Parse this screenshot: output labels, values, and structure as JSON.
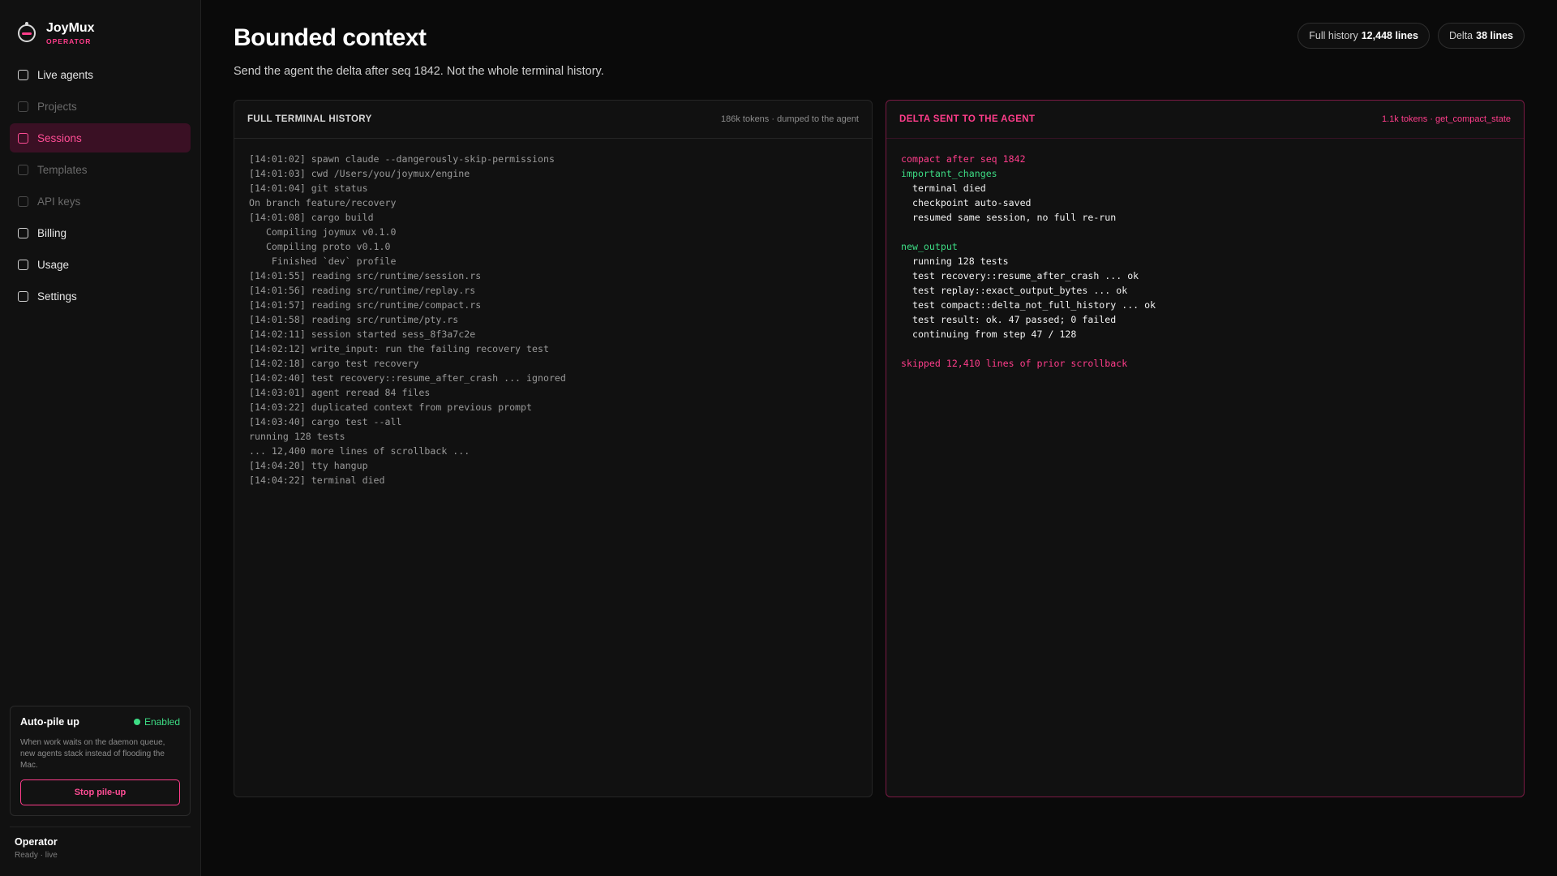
{
  "sidebar": {
    "brand": {
      "name": "JoyMux",
      "role": "OPERATOR"
    },
    "items": [
      {
        "label": "Live agents",
        "state": "normal"
      },
      {
        "label": "Projects",
        "state": "dim"
      },
      {
        "label": "Sessions",
        "state": "active"
      },
      {
        "label": "Templates",
        "state": "dim"
      },
      {
        "label": "API keys",
        "state": "dim"
      },
      {
        "label": "Billing",
        "state": "normal"
      },
      {
        "label": "Usage",
        "state": "normal"
      },
      {
        "label": "Settings",
        "state": "normal"
      }
    ],
    "pile": {
      "title": "Auto-pile up",
      "status": "Enabled",
      "description": "When work waits on the daemon queue, new agents stack instead of flooding the Mac.",
      "button": "Stop pile-up"
    },
    "operator": {
      "name": "Operator",
      "status": "Ready · live"
    }
  },
  "header": {
    "title": "Bounded context",
    "subtitle": "Send the agent the delta after seq 1842. Not the whole terminal history.",
    "pills": [
      {
        "label": "Full history",
        "value": "12,448 lines"
      },
      {
        "label": "Delta",
        "value": "38 lines"
      }
    ]
  },
  "full_panel": {
    "title": "FULL TERMINAL HISTORY",
    "meta": "186k tokens · dumped to the agent",
    "lines": [
      "[14:01:02] spawn claude --dangerously-skip-permissions",
      "[14:01:03] cwd /Users/you/joymux/engine",
      "[14:01:04] git status",
      "On branch feature/recovery",
      "[14:01:08] cargo build",
      "   Compiling joymux v0.1.0",
      "   Compiling proto v0.1.0",
      "    Finished `dev` profile",
      "[14:01:55] reading src/runtime/session.rs",
      "[14:01:56] reading src/runtime/replay.rs",
      "[14:01:57] reading src/runtime/compact.rs",
      "[14:01:58] reading src/runtime/pty.rs",
      "[14:02:11] session started sess_8f3a7c2e",
      "[14:02:12] write_input: run the failing recovery test",
      "[14:02:18] cargo test recovery",
      "[14:02:40] test recovery::resume_after_crash ... ignored",
      "[14:03:01] agent reread 84 files",
      "[14:03:22] duplicated context from previous prompt",
      "[14:03:40] cargo test --all",
      "running 128 tests",
      "... 12,400 more lines of scrollback ...",
      "[14:04:20] tty hangup",
      "[14:04:22] terminal died"
    ]
  },
  "delta_panel": {
    "title": "DELTA SENT TO THE AGENT",
    "meta": "1.1k tokens · get_compact_state",
    "lines": [
      {
        "text": "compact after seq 1842",
        "tone": "pink"
      },
      {
        "text": "important_changes",
        "tone": "green"
      },
      {
        "text": "  terminal died",
        "tone": "normal"
      },
      {
        "text": "  checkpoint auto-saved",
        "tone": "normal"
      },
      {
        "text": "  resumed same session, no full re-run",
        "tone": "normal"
      },
      {
        "text": "",
        "tone": "normal"
      },
      {
        "text": "new_output",
        "tone": "green"
      },
      {
        "text": "  running 128 tests",
        "tone": "normal"
      },
      {
        "text": "  test recovery::resume_after_crash ... ok",
        "tone": "normal"
      },
      {
        "text": "  test replay::exact_output_bytes ... ok",
        "tone": "normal"
      },
      {
        "text": "  test compact::delta_not_full_history ... ok",
        "tone": "normal"
      },
      {
        "text": "  test result: ok. 47 passed; 0 failed",
        "tone": "normal"
      },
      {
        "text": "  continuing from step 47 / 128",
        "tone": "normal"
      },
      {
        "text": "",
        "tone": "normal"
      },
      {
        "text": "skipped 12,410 lines of prior scrollback",
        "tone": "pink"
      }
    ]
  },
  "colors": {
    "accent": "#ff3d8b",
    "success": "#3ddc84",
    "background": "#0a0a0a"
  }
}
